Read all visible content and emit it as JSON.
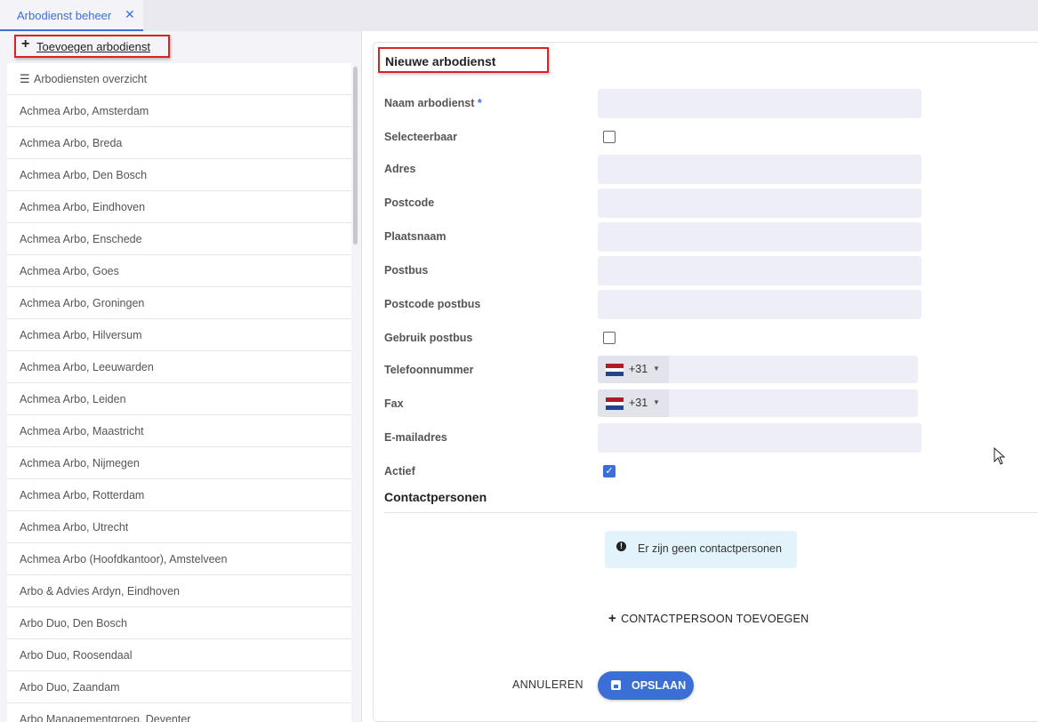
{
  "tab": {
    "label": "Arbodienst beheer",
    "close": "✕"
  },
  "sidebar": {
    "add_label": "Toevoegen arbodienst",
    "add_icon": "+",
    "overview_label": "Arbodiensten overzicht",
    "items": [
      "Achmea Arbo, Amsterdam",
      "Achmea Arbo, Breda",
      "Achmea Arbo, Den Bosch",
      "Achmea Arbo, Eindhoven",
      "Achmea Arbo, Enschede",
      "Achmea Arbo, Goes",
      "Achmea Arbo, Groningen",
      "Achmea Arbo, Hilversum",
      "Achmea Arbo, Leeuwarden",
      "Achmea Arbo, Leiden",
      "Achmea Arbo, Maastricht",
      "Achmea Arbo, Nijmegen",
      "Achmea Arbo, Rotterdam",
      "Achmea Arbo, Utrecht",
      "Achmea Arbo (Hoofdkantoor), Amstelveen",
      "Arbo & Advies Ardyn, Eindhoven",
      "Arbo Duo, Den Bosch",
      "Arbo Duo, Roosendaal",
      "Arbo Duo, Zaandam",
      "Arbo Managementgroep, Deventer"
    ]
  },
  "form": {
    "title": "Nieuwe arbodienst",
    "naam_label": "Naam arbodienst",
    "required_mark": "*",
    "selecteerbaar_label": "Selecteerbaar",
    "adres_label": "Adres",
    "postcode_label": "Postcode",
    "plaatsnaam_label": "Plaatsnaam",
    "postbus_label": "Postbus",
    "postcode_postbus_label": "Postcode postbus",
    "gebruik_postbus_label": "Gebruik postbus",
    "telefoon_label": "Telefoonnummer",
    "telefoon_code": "+31",
    "fax_label": "Fax",
    "fax_code": "+31",
    "email_label": "E-mailadres",
    "actief_label": "Actief",
    "selecteerbaar_checked": false,
    "gebruik_postbus_checked": false,
    "actief_checked": true
  },
  "contacts": {
    "title": "Contactpersonen",
    "empty_message": "Er zijn geen contactpersonen",
    "add_label": "CONTACTPERSOON TOEVOEGEN"
  },
  "actions": {
    "cancel_label": "ANNULEREN",
    "save_label": "OPSLAAN"
  },
  "colors": {
    "accent": "#3c6fd6",
    "highlight_border": "#dd2222",
    "info_bg": "#e3f3fb"
  }
}
